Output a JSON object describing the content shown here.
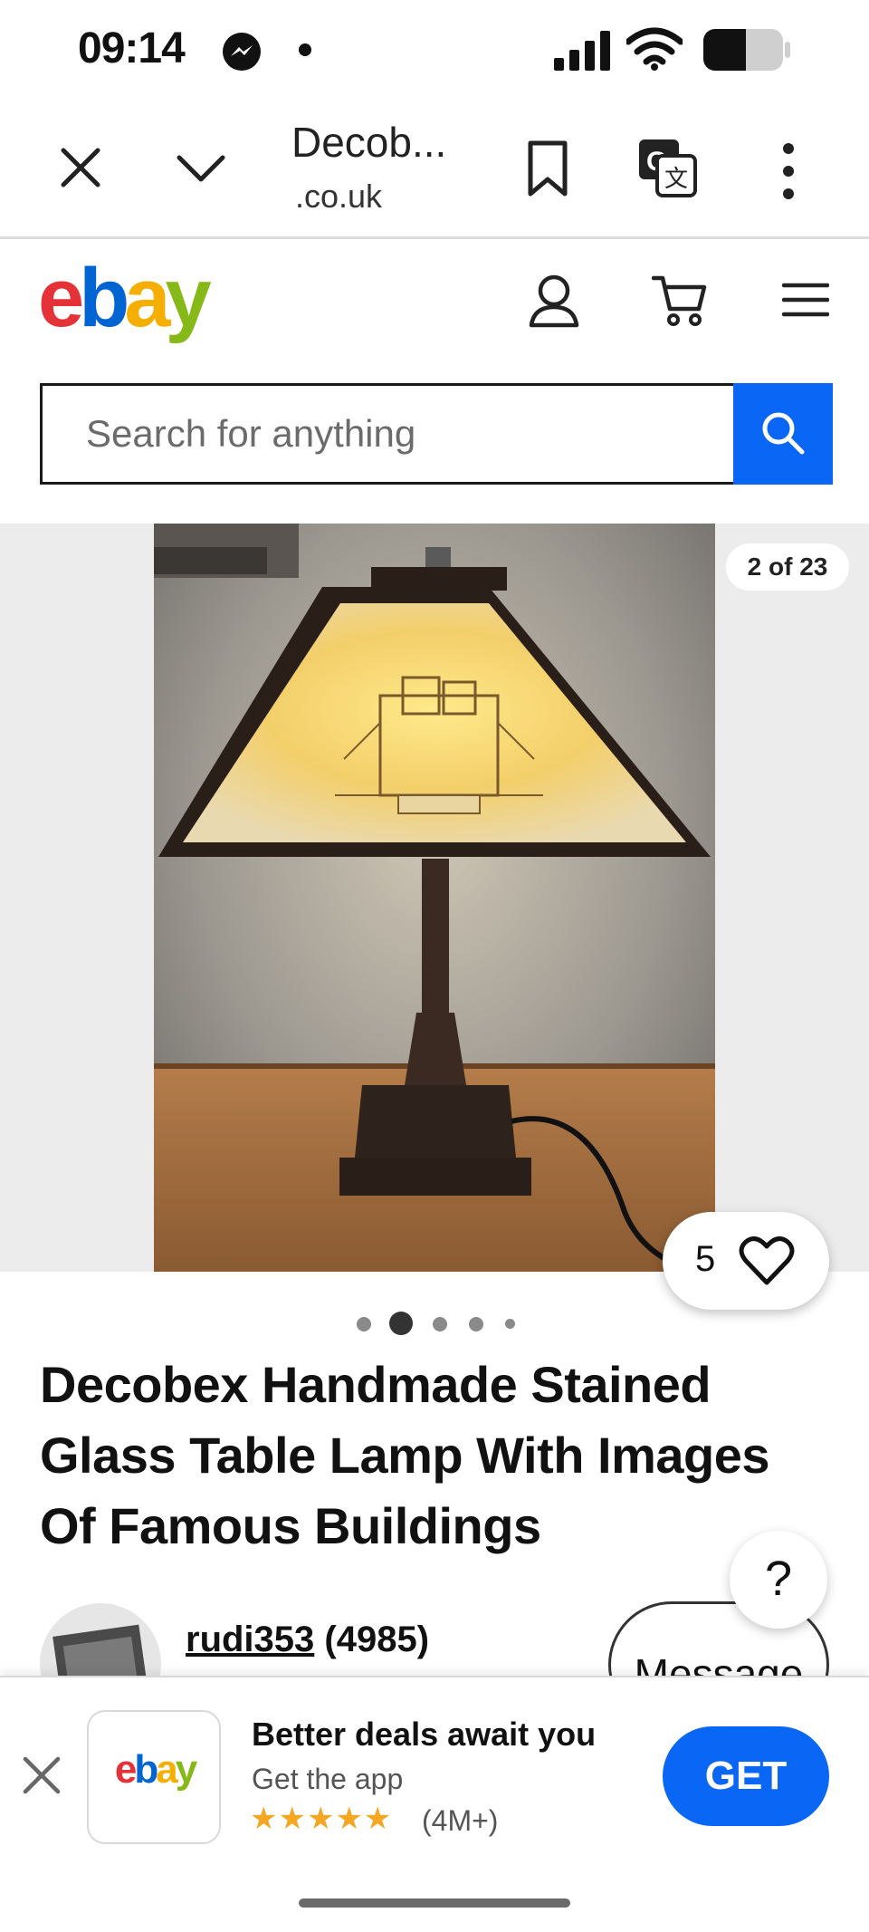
{
  "status_bar": {
    "time": "09:14",
    "icons": [
      "messenger-icon",
      "dot-indicator",
      "signal-icon",
      "wifi-icon",
      "battery-icon"
    ]
  },
  "browser_bar": {
    "title": "Decob...",
    "domain": ".co.uk",
    "icons": [
      "close-icon",
      "chevron-down-icon",
      "bookmark-icon",
      "translate-icon",
      "more-vertical-icon"
    ]
  },
  "header": {
    "logo": {
      "e": "e",
      "b": "b",
      "a": "a",
      "y": "y"
    },
    "logo_colors": {
      "e": "#e53238",
      "b": "#0064d2",
      "a": "#f5af02",
      "y": "#86b817"
    },
    "icons": [
      "user-icon",
      "cart-icon",
      "menu-icon"
    ]
  },
  "search": {
    "placeholder": "Search for anything",
    "button_color": "#0a66f5"
  },
  "gallery": {
    "counter": "2 of 23",
    "watch_count": "5",
    "pager_dots": 5,
    "active_dot": 2
  },
  "item": {
    "title": "Decobex Handmade Stained Glass Table Lamp With Images Of Famous Buildings"
  },
  "help": {
    "label": "?"
  },
  "seller": {
    "username": "rudi353",
    "feedback": "(4985)",
    "message_label": "Message"
  },
  "app_banner": {
    "headline": "Better deals await you",
    "subline": "Get the app",
    "stars": "★★★★★",
    "rating_count": "(4M+)",
    "get_label": "GET"
  }
}
